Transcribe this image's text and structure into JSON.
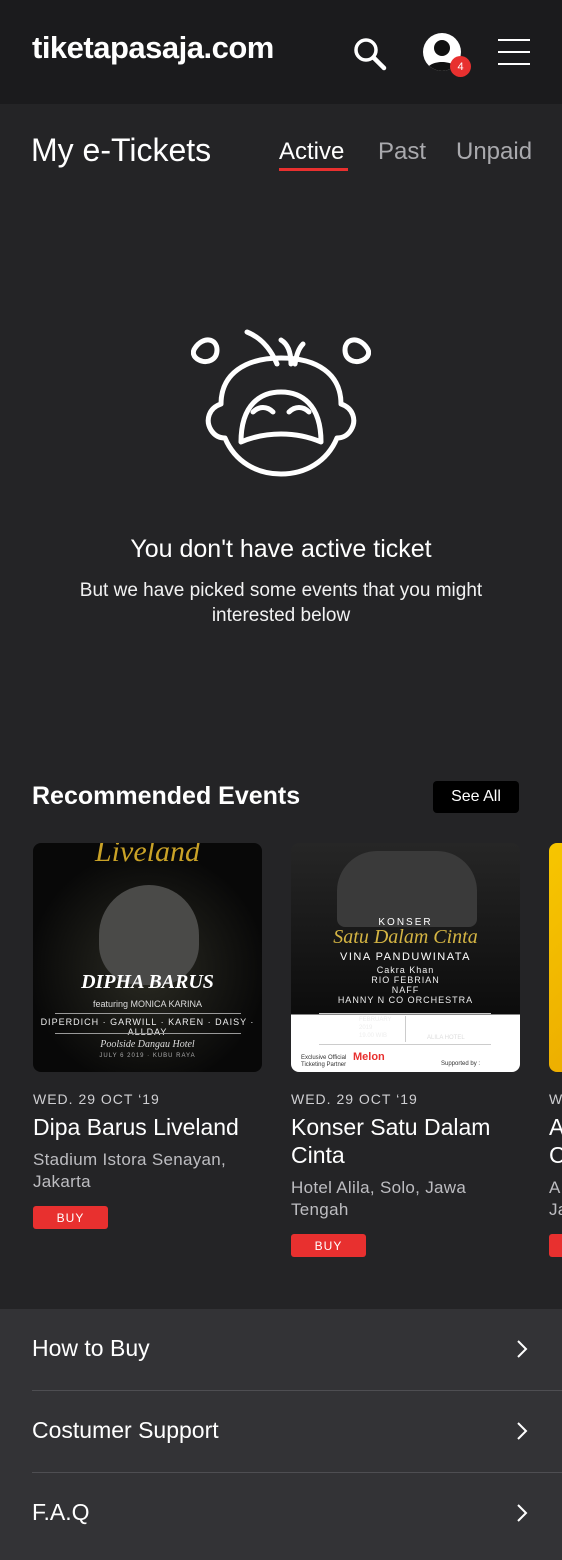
{
  "header": {
    "logo_text": "tiketapasaja.com",
    "notification_count": "4",
    "icons": [
      "search-icon",
      "user-avatar-icon",
      "hamburger-menu-icon"
    ]
  },
  "page": {
    "title": "My e-Tickets",
    "tabs": [
      {
        "label": "Active",
        "selected": true
      },
      {
        "label": "Past",
        "selected": false
      },
      {
        "label": "Unpaid",
        "selected": false
      }
    ]
  },
  "empty_state": {
    "icon": "crying-face-icon",
    "title": "You don't have active ticket",
    "subtitle": "But we have picked some events that you might interested below"
  },
  "recommended": {
    "title": "Recommended Events",
    "see_all_label": "See All",
    "events": [
      {
        "date": "WED. 29 OCT ‘19",
        "name": "Dipa Barus Liveland",
        "venue": "Stadium Istora Senayan, Jakarta",
        "buy_label": "BUY",
        "poster": {
          "headline": "Liveland",
          "artist": "DIPHA BARUS",
          "featuring": "featuring MONICA KARINA",
          "guests": "DIPERDICH · GARWILL · KAREN · DAISY · ALLDAY",
          "venue": "Poolside Dangau Hotel",
          "when": "JULY 6 2019 · KUBU RAYA"
        }
      },
      {
        "date": "WED. 29 OCT ‘19",
        "name": "Konser Satu Dalam Cinta",
        "venue": "Hotel Alila, Solo, Jawa Tengah",
        "buy_label": "BUY",
        "poster": {
          "konser": "KONSER",
          "title": "Satu Dalam Cinta",
          "headliner": "VINA PANDUWINATA",
          "guests": [
            "Cakra Khan",
            "RIO FEBRIAN",
            "NAFF",
            "HANNY N CO ORCHESTRA"
          ],
          "day": "23",
          "month": "FEBRUARY",
          "year": "2019",
          "time": "19.00 WIB",
          "city": "SOLO",
          "hotel": "ALILA HOTEL",
          "partner_text": "Exclusive Official Ticketing Partner",
          "partner_brand": "Melon",
          "supported_by": "Supported by :"
        }
      },
      {
        "date": "W",
        "name": "A C",
        "venue": "A Ja",
        "buy_label": ""
      }
    ]
  },
  "footer_links": [
    {
      "label": "How to Buy"
    },
    {
      "label": "Costumer Support"
    },
    {
      "label": "F.A.Q"
    }
  ],
  "colors": {
    "background": "#242426",
    "header": "#1b1b1d",
    "accent": "#e8302f",
    "footer": "#333336"
  }
}
